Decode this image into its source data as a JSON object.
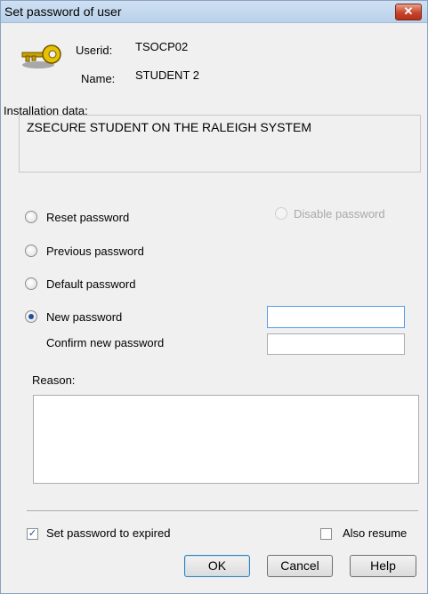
{
  "window": {
    "title": "Set password of user",
    "close_glyph": "✕"
  },
  "icon": "key-icon",
  "user": {
    "userid_label": "Userid:",
    "userid_value": "TSOCP02",
    "name_label": "Name:",
    "name_value": "STUDENT 2"
  },
  "installation": {
    "label": "Installation data:",
    "value": "ZSECURE STUDENT ON THE RALEIGH SYSTEM"
  },
  "options": {
    "reset": "Reset password",
    "disable": "Disable password",
    "previous": "Previous password",
    "default": "Default password",
    "new": "New password",
    "confirm": "Confirm new password",
    "selected": "new"
  },
  "fields": {
    "new_password_value": "",
    "confirm_password_value": ""
  },
  "reason": {
    "label": "Reason:",
    "value": ""
  },
  "checkboxes": {
    "expired_label": "Set password to expired",
    "expired_checked": true,
    "resume_label": "Also resume",
    "resume_checked": false
  },
  "buttons": {
    "ok": "OK",
    "cancel": "Cancel",
    "help": "Help"
  }
}
